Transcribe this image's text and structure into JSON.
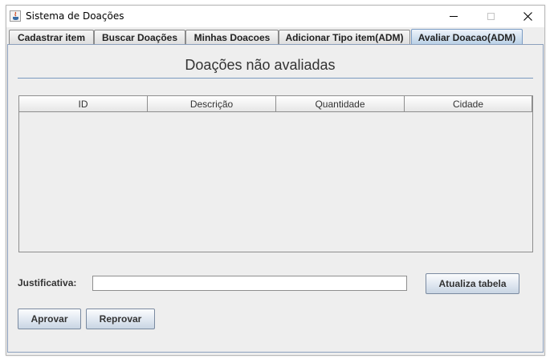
{
  "window": {
    "title": "Sistema de Doações"
  },
  "tabs": [
    {
      "label": "Cadastrar item"
    },
    {
      "label": "Buscar Doações"
    },
    {
      "label": "Minhas Doacoes"
    },
    {
      "label": "Adicionar Tipo item(ADM)"
    },
    {
      "label": "Avaliar Doacao(ADM)",
      "selected": true
    }
  ],
  "panel": {
    "heading": "Doações não avaliadas",
    "table": {
      "columns": [
        "ID",
        "Descrição",
        "Quantidade",
        "Cidade"
      ],
      "rows": []
    },
    "justificativa": {
      "label": "Justificativa:",
      "value": ""
    },
    "buttons": {
      "refresh": "Atualiza tabela",
      "approve": "Aprovar",
      "reject": "Reprovar"
    }
  },
  "colors": {
    "active_tab": "#b8cfe5",
    "separator": "#7a99bf"
  },
  "icons": [
    "java-app-icon",
    "minimize-icon",
    "maximize-icon",
    "close-icon"
  ]
}
